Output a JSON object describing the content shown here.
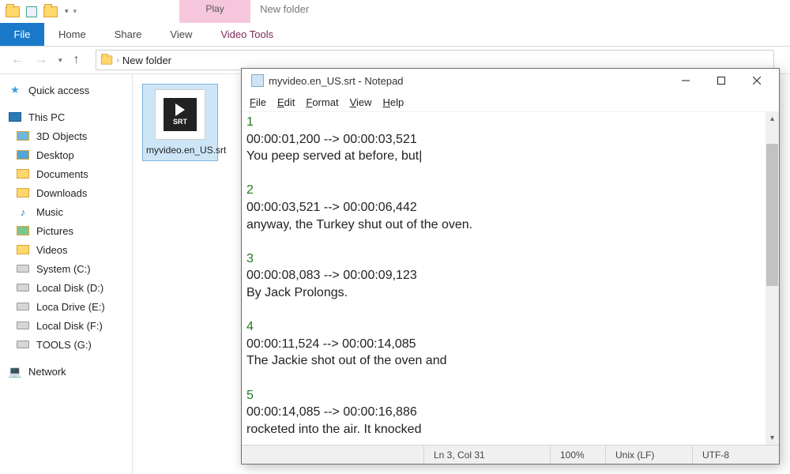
{
  "titlebar": {
    "contextual_label": "Play",
    "window_title": "New folder"
  },
  "ribbon": {
    "file_tab": "File",
    "tabs": [
      "Home",
      "Share",
      "View"
    ],
    "contextual_tab": "Video Tools"
  },
  "address": {
    "segment": "New folder"
  },
  "sidebar": {
    "quick_access": "Quick access",
    "this_pc": "This PC",
    "items": [
      "3D Objects",
      "Desktop",
      "Documents",
      "Downloads",
      "Music",
      "Pictures",
      "Videos",
      "System (C:)",
      "Local Disk (D:)",
      "Loca Drive (E:)",
      "Local Disk (F:)",
      "TOOLS (G:)"
    ],
    "network": "Network"
  },
  "file": {
    "name": "myvideo.en_US.srt",
    "badge": "SRT"
  },
  "notepad": {
    "title": "myvideo.en_US.srt - Notepad",
    "menu": [
      "File",
      "Edit",
      "Format",
      "View",
      "Help"
    ],
    "entries": [
      {
        "n": "1",
        "time": "00:00:01,200 --> 00:00:03,521",
        "text": "You peep served at before, but"
      },
      {
        "n": "2",
        "time": "00:00:03,521 --> 00:00:06,442",
        "text": "anyway, the Turkey shut out of the oven."
      },
      {
        "n": "3",
        "time": "00:00:08,083 --> 00:00:09,123",
        "text": "By Jack Prolongs."
      },
      {
        "n": "4",
        "time": "00:00:11,524 --> 00:00:14,085",
        "text": "The Jackie shot out of the oven and"
      },
      {
        "n": "5",
        "time": "00:00:14,085 --> 00:00:16,886",
        "text": "rocketed into the air. It knocked"
      }
    ],
    "status": {
      "position": "Ln 3, Col 31",
      "zoom": "100%",
      "eol": "Unix (LF)",
      "encoding": "UTF-8"
    }
  }
}
